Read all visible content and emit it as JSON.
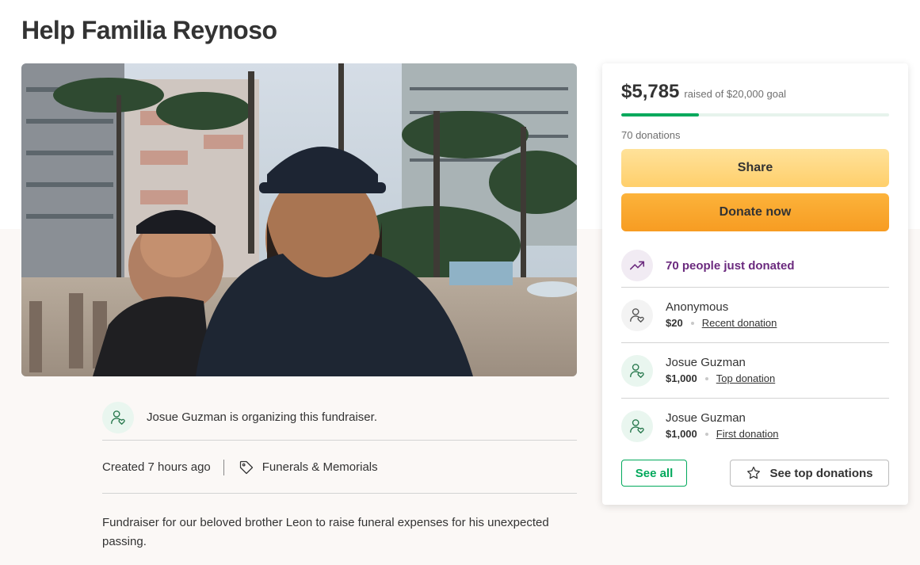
{
  "page": {
    "title": "Help Familia Reynoso"
  },
  "organizer": {
    "text": "Josue Guzman is organizing this fundraiser."
  },
  "meta": {
    "created": "Created 7 hours ago",
    "category": "Funerals & Memorials"
  },
  "story": {
    "text": "Fundraiser for our beloved brother Leon to raise funeral expenses for his unexpected passing."
  },
  "card": {
    "raised": "$5,785",
    "goal_text": "raised of $20,000 goal",
    "progress_fraction": 0.289,
    "donations_count": "70 donations",
    "share_label": "Share",
    "donate_label": "Donate now",
    "trend_text": "70 people just donated",
    "donors": [
      {
        "name": "Anonymous",
        "amount": "$20",
        "kind": "Recent donation"
      },
      {
        "name": "Josue Guzman",
        "amount": "$1,000",
        "kind": "Top donation"
      },
      {
        "name": "Josue Guzman",
        "amount": "$1,000",
        "kind": "First donation"
      }
    ],
    "see_all_label": "See all",
    "see_top_label": "See top donations"
  },
  "colors": {
    "brand_green": "#02a95c",
    "trend_purple": "#6b2a7e",
    "donate_orange": "#f79c22",
    "share_yellow": "#ffcf6b"
  },
  "icons": {
    "organizer": "person-heart-icon",
    "category": "tag-icon",
    "trend": "trending-up-icon",
    "star": "star-icon"
  }
}
